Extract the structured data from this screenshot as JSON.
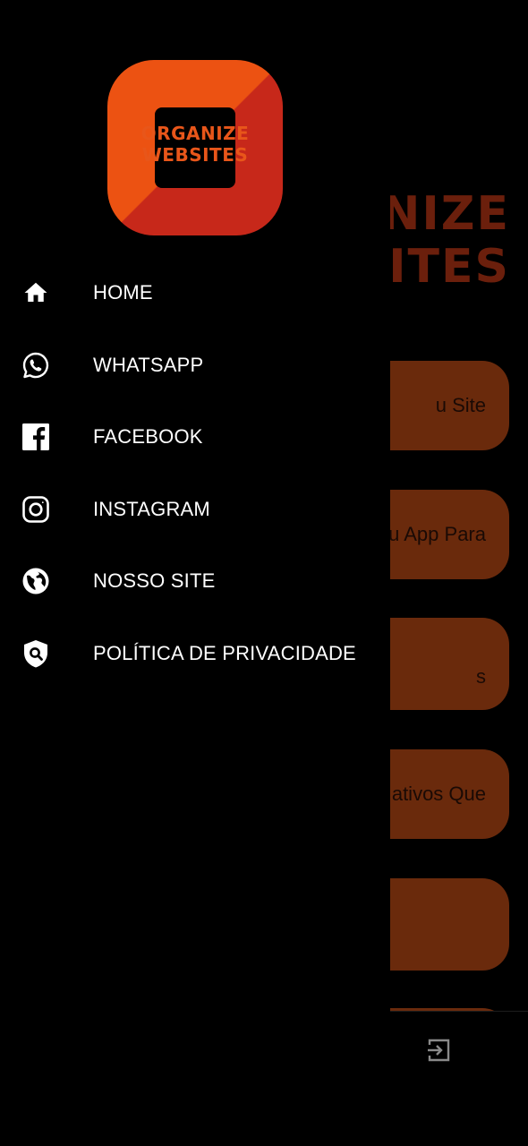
{
  "background": {
    "logo_line1": "NIZE",
    "logo_line2": "ITES",
    "buttons": [
      {
        "label": "u Site"
      },
      {
        "label": "u App Para"
      },
      {
        "label": "s"
      },
      {
        "label": "ativos Que"
      },
      {
        "label": ""
      }
    ],
    "exit_icon": "exit-icon"
  },
  "drawer": {
    "logo": {
      "line1": "ORGANIZE",
      "line2": "WEBSITES"
    },
    "menu": [
      {
        "label": "HOME",
        "icon": "home-icon"
      },
      {
        "label": "WHATSAPP",
        "icon": "whatsapp-icon"
      },
      {
        "label": "FACEBOOK",
        "icon": "facebook-icon"
      },
      {
        "label": "INSTAGRAM",
        "icon": "instagram-icon"
      },
      {
        "label": "NOSSO SITE",
        "icon": "globe-icon"
      },
      {
        "label": "POLÍTICA DE PRIVACIDADE",
        "icon": "shield-search-icon"
      }
    ]
  },
  "colors": {
    "logo_orange": "#ec5212",
    "logo_red": "#c7281a",
    "button_dimmed": "#6a2a0c",
    "background": "#000000",
    "text": "#ffffff"
  }
}
